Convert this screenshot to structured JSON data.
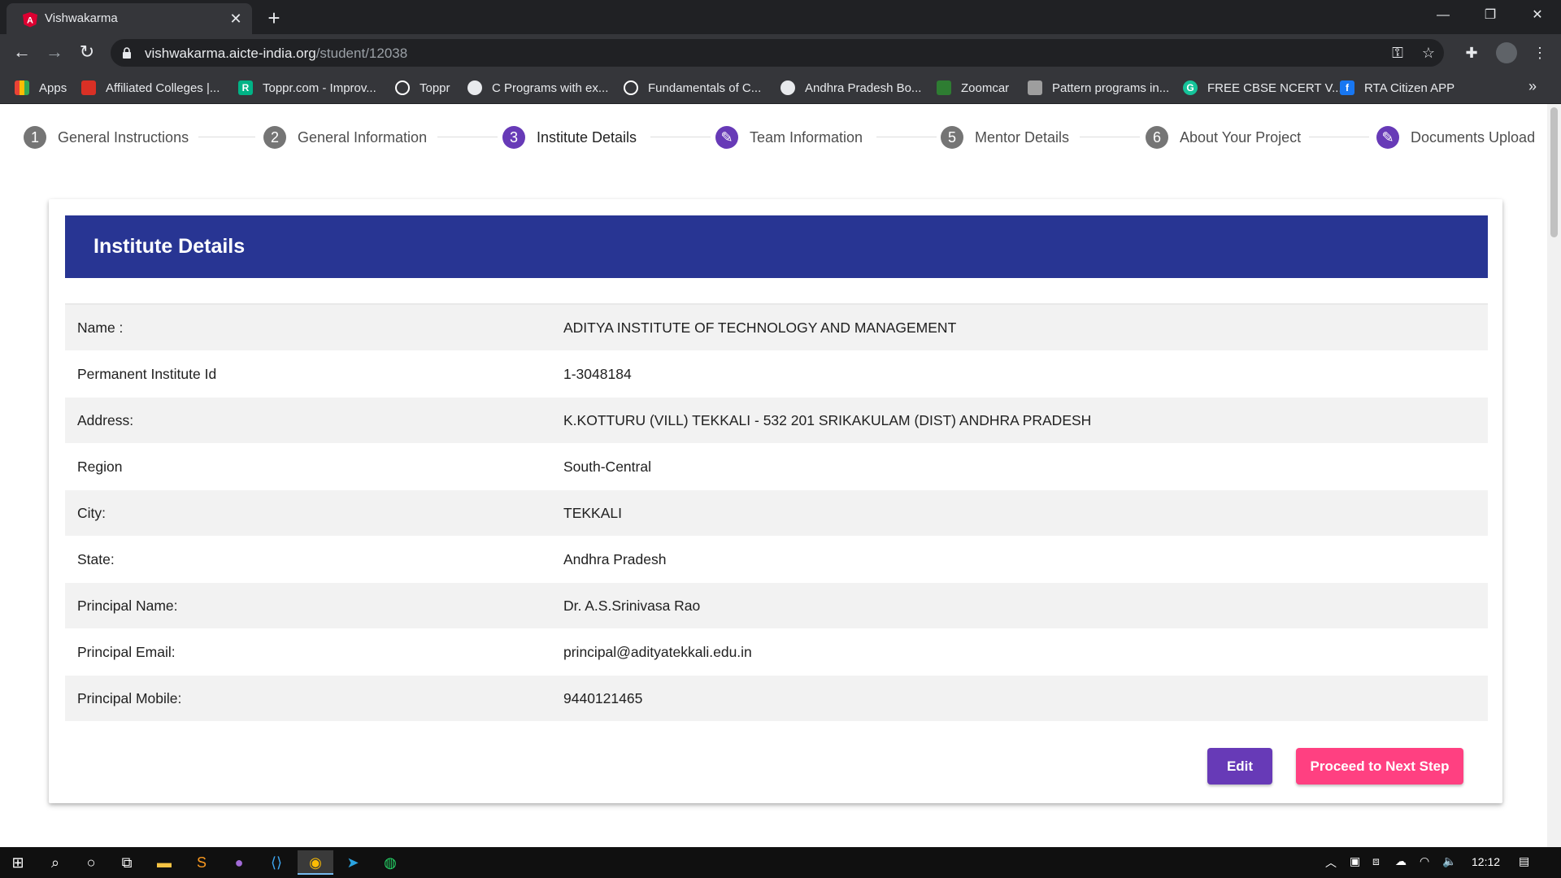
{
  "browser": {
    "tab_title": "Vishwakarma",
    "url_host": "vishwakarma.aicte-india.org",
    "url_path": "/student/12038",
    "bookmarks": [
      {
        "label": "Apps",
        "icon": "apps-grid-icon",
        "color": "#ea4335"
      },
      {
        "label": "Affiliated Colleges |...",
        "icon": "college-icon",
        "color": "#d93025"
      },
      {
        "label": "Toppr.com - Improv...",
        "icon": "toppr-icon",
        "color": "#00b386"
      },
      {
        "label": "Toppr",
        "icon": "wordpress-icon",
        "color": "#ffffff"
      },
      {
        "label": "C Programs with ex...",
        "icon": "globe-icon",
        "color": "#ffffff"
      },
      {
        "label": "Fundamentals of C...",
        "icon": "wordpress-icon",
        "color": "#ffffff"
      },
      {
        "label": "Andhra Pradesh Bo...",
        "icon": "globe-icon",
        "color": "#ffffff"
      },
      {
        "label": "Zoomcar",
        "icon": "zoomcar-icon",
        "color": "#2e7d32"
      },
      {
        "label": "Pattern programs in...",
        "icon": "pattern-icon",
        "color": "#9e9e9e"
      },
      {
        "label": "FREE CBSE NCERT V...",
        "icon": "grammarly-icon",
        "color": "#15c39a"
      },
      {
        "label": "RTA Citizen APP",
        "icon": "facebook-icon",
        "color": "#1877f2"
      }
    ]
  },
  "stepper": {
    "steps": [
      {
        "num": "1",
        "label": "General Instructions",
        "state": "done"
      },
      {
        "num": "2",
        "label": "General Information",
        "state": "done"
      },
      {
        "num": "3",
        "label": "Institute Details",
        "state": "active"
      },
      {
        "num": "✎",
        "label": "Team Information",
        "state": "edit"
      },
      {
        "num": "5",
        "label": "Mentor Details",
        "state": "done"
      },
      {
        "num": "6",
        "label": "About Your Project",
        "state": "done"
      },
      {
        "num": "✎",
        "label": "Documents Upload",
        "state": "edit"
      }
    ]
  },
  "card": {
    "title": "Institute Details",
    "rows": [
      {
        "label": "Name :",
        "value": "ADITYA INSTITUTE OF TECHNOLOGY AND MANAGEMENT"
      },
      {
        "label": "Permanent Institute Id",
        "value": "1-3048184"
      },
      {
        "label": "Address:",
        "value": "K.KOTTURU (VILL) TEKKALI - 532 201 SRIKAKULAM (DIST) ANDHRA PRADESH"
      },
      {
        "label": "Region",
        "value": "South-Central"
      },
      {
        "label": "City:",
        "value": "TEKKALI"
      },
      {
        "label": "State:",
        "value": "Andhra Pradesh"
      },
      {
        "label": "Principal Name:",
        "value": "Dr. A.S.Srinivasa Rao"
      },
      {
        "label": "Principal Email:",
        "value": "principal@adityatekkali.edu.in"
      },
      {
        "label": "Principal Mobile:",
        "value": "9440121465"
      }
    ],
    "edit_label": "Edit",
    "next_label": "Proceed to Next Step"
  },
  "taskbar": {
    "clock": "12:12"
  },
  "colors": {
    "header_blue": "#283593",
    "primary_purple": "#673ab7",
    "accent_pink": "#ff4081"
  }
}
